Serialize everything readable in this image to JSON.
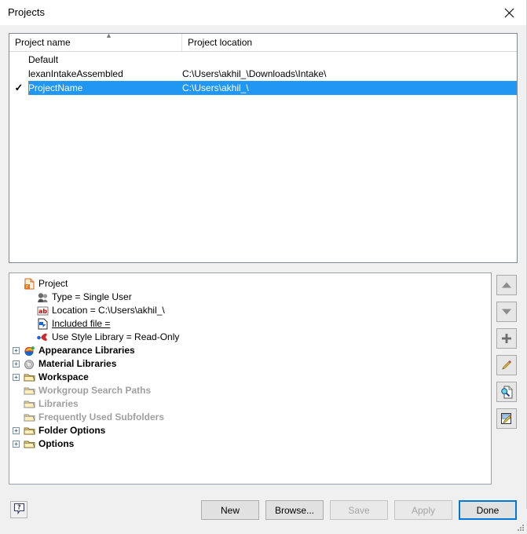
{
  "window": {
    "title": "Projects",
    "close_icon": "close-icon"
  },
  "list": {
    "columns": [
      {
        "label": "Project name",
        "sort": "ascending",
        "sort_icon": "sort-ascending-caret"
      },
      {
        "label": "Project location",
        "sort": "none"
      }
    ],
    "rows": [
      {
        "check": "",
        "name": "Default",
        "location": "",
        "selected": false
      },
      {
        "check": "",
        "name": "lexanIntakeAssembled",
        "location": "C:\\Users\\akhil_\\Downloads\\Intake\\",
        "selected": false
      },
      {
        "check": "✓",
        "name": "ProjectName",
        "location": "C:\\Users\\akhil_\\",
        "selected": true
      }
    ],
    "selection_color": "#2196f3",
    "selection_text_color": "#ffffff"
  },
  "tree": {
    "nodes": [
      {
        "label": "Project",
        "icon": "project-document-icon",
        "indent": 0,
        "expander": "none",
        "style": "normal"
      },
      {
        "label": "Type = Single User",
        "icon": "user-type-icon",
        "indent": 1,
        "expander": "none",
        "style": "normal"
      },
      {
        "label": "Location = C:\\Users\\akhil_\\",
        "icon": "ab-text-icon",
        "indent": 1,
        "expander": "none",
        "style": "normal"
      },
      {
        "label": "Included file =",
        "icon": "included-file-icon",
        "indent": 1,
        "expander": "none",
        "style": "link"
      },
      {
        "label": "Use Style Library = Read-Only",
        "icon": "style-library-icon",
        "indent": 1,
        "expander": "none",
        "style": "normal"
      },
      {
        "label": "Appearance Libraries",
        "icon": "appearance-sphere-icon",
        "indent": 0,
        "expander": "plus",
        "style": "bold"
      },
      {
        "label": "Material Libraries",
        "icon": "material-sphere-icon",
        "indent": 0,
        "expander": "plus",
        "style": "bold"
      },
      {
        "label": "Workspace",
        "icon": "folder-icon",
        "indent": 0,
        "expander": "plus",
        "style": "bold"
      },
      {
        "label": "Workgroup Search Paths",
        "icon": "folder-icon",
        "indent": 0,
        "expander": "none",
        "style": "dim"
      },
      {
        "label": "Libraries",
        "icon": "folder-icon",
        "indent": 0,
        "expander": "none",
        "style": "dim"
      },
      {
        "label": "Frequently Used Subfolders",
        "icon": "folder-icon",
        "indent": 0,
        "expander": "none",
        "style": "dim"
      },
      {
        "label": "Folder Options",
        "icon": "folder-icon",
        "indent": 0,
        "expander": "plus",
        "style": "bold"
      },
      {
        "label": "Options",
        "icon": "folder-icon",
        "indent": 0,
        "expander": "plus",
        "style": "bold"
      }
    ]
  },
  "side_toolbar": {
    "buttons": [
      {
        "name": "move-up-button",
        "icon": "arrow-up-icon"
      },
      {
        "name": "move-down-button",
        "icon": "arrow-down-icon"
      },
      {
        "name": "add-button",
        "icon": "plus-icon"
      },
      {
        "name": "edit-button",
        "icon": "pencil-icon"
      },
      {
        "name": "browse-button",
        "icon": "magnifier-page-icon"
      },
      {
        "name": "edit-page-button",
        "icon": "edit-page-icon"
      }
    ]
  },
  "footer": {
    "help_icon": "help-question-icon",
    "buttons": [
      {
        "label": "New",
        "state": "enabled"
      },
      {
        "label": "Browse...",
        "state": "enabled"
      },
      {
        "label": "Save",
        "state": "disabled"
      },
      {
        "label": "Apply",
        "state": "disabled"
      },
      {
        "label": "Done",
        "state": "default"
      }
    ]
  }
}
